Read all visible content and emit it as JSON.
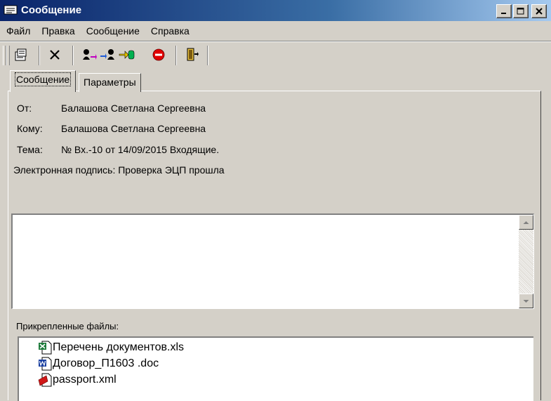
{
  "window": {
    "title": "Сообщение"
  },
  "menu": [
    "Файл",
    "Правка",
    "Сообщение",
    "Справка"
  ],
  "toolbar": {
    "icons": [
      "properties-icon",
      "delete-icon",
      "reply-icon",
      "reply-all-icon",
      "forward-icon",
      "stop-icon",
      "exit-icon"
    ]
  },
  "tabs": [
    {
      "label": "Сообщение",
      "active": true
    },
    {
      "label": "Параметры",
      "active": false
    }
  ],
  "header": {
    "from_label": "От:",
    "from_value": "Балашова Светлана Сергеевна",
    "to_label": "Кому:",
    "to_value": "Балашова Светлана Сергеевна",
    "subject_label": "Тема:",
    "subject_value": "№ Вх.-10 от 14/09/2015 Входящие.",
    "signature": "Электронная подпись: Проверка ЭЦП прошла"
  },
  "body_text": "",
  "attachments": {
    "label": "Прикрепленные файлы:",
    "files": [
      {
        "name": "Перечень документов.xls",
        "icon": "excel-file-icon"
      },
      {
        "name": "Договор_П1603 .doc",
        "icon": "word-file-icon"
      },
      {
        "name": "passport.xml",
        "icon": "xml-file-icon"
      }
    ]
  },
  "colors": {
    "titlebar_start": "#0a246a",
    "titlebar_end": "#a6caf0",
    "face": "#d4d0c8"
  }
}
